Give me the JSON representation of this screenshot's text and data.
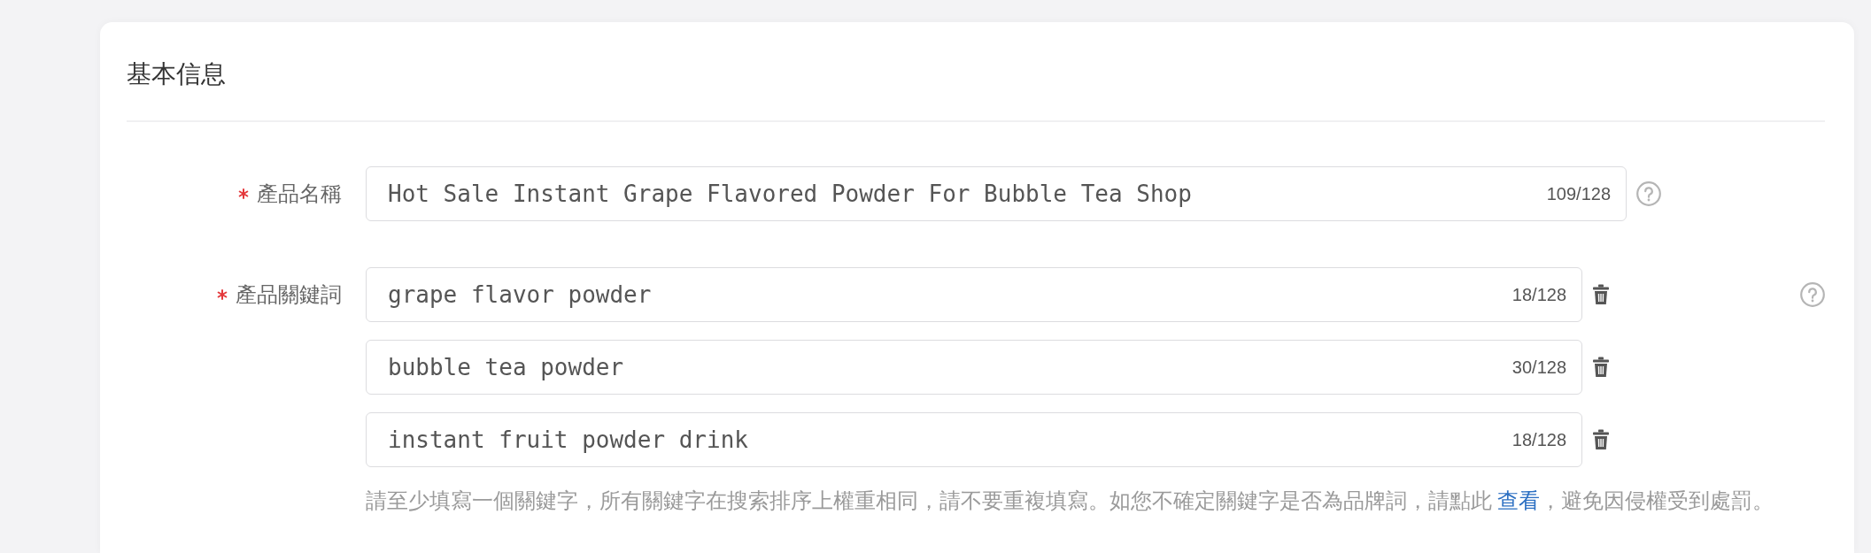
{
  "section": {
    "title": "基本信息"
  },
  "fields": [
    {
      "kind": "text",
      "label": "產品名稱",
      "required": true,
      "value": "Hot Sale Instant Grape Flavored Powder For Bubble Tea Shop",
      "count": "109/128"
    },
    {
      "kind": "keywords",
      "label": "產品關鍵詞",
      "required": true,
      "items": [
        {
          "value": "grape flavor powder",
          "count": "18/128"
        },
        {
          "value": "bubble tea powder",
          "count": "30/128"
        },
        {
          "value": "instant fruit powder drink",
          "count": "18/128"
        }
      ],
      "hint": {
        "text_before": "請至少填寫一個關鍵字，所有關鍵字在搜索排序上權重相同，請不要重複填寫。如您不確定關鍵字是否為品牌詞，請點此",
        "link": "查看",
        "text_after": "，避免因侵權受到處罰。"
      }
    }
  ]
}
